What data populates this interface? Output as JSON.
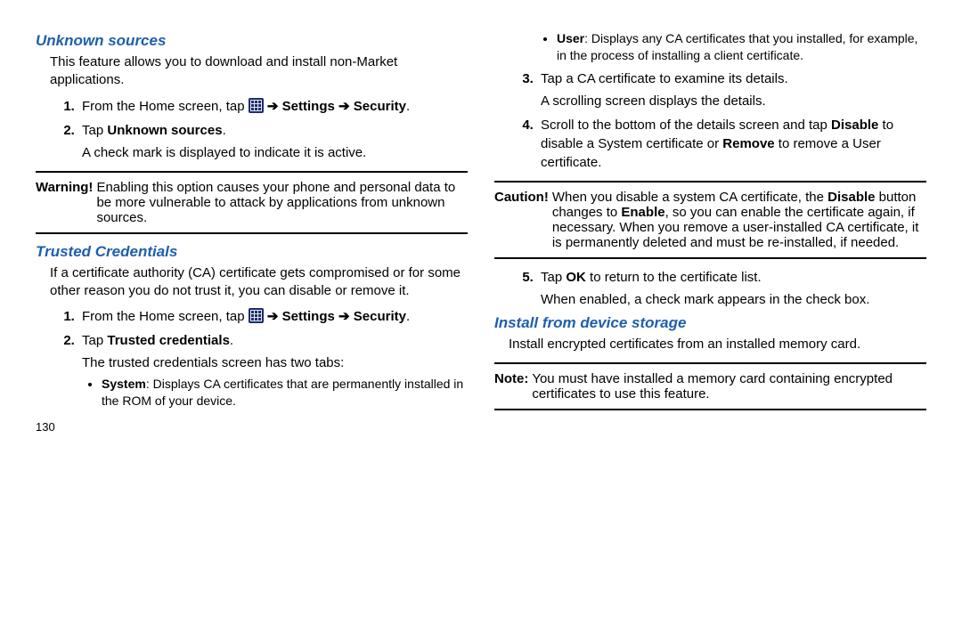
{
  "pageNumber": "130",
  "arrow": "➔",
  "left": {
    "h1": "Unknown sources",
    "intro1": "This feature allows you to download and install non-Market applications.",
    "step1_pre": "From the Home screen, tap ",
    "settings": "Settings",
    "security": "Security",
    "step2_pre": "Tap ",
    "step2_b": "Unknown sources",
    "step2_post": ".",
    "step2_sub": "A check mark is displayed to indicate it is active.",
    "warn_label": "Warning!",
    "warn_body": "Enabling this option causes your phone and personal data to be more vulnerable to attack by applications from unknown sources.",
    "h2": "Trusted Credentials",
    "intro2": "If a certificate authority (CA) certificate gets compromised or for some other reason you do not trust it, you can disable or remove it.",
    "step2b_b": "Trusted credentials",
    "step2b_sub": "The trusted credentials screen has two tabs:",
    "bullet_sys_b": "System",
    "bullet_sys": ": Displays CA certificates that are permanently installed in the ROM of your device."
  },
  "right": {
    "bullet_user_b": "User",
    "bullet_user": ": Displays any CA certificates that you installed, for example, in the process of installing a client certificate.",
    "step3a": "Tap a CA certificate to examine its details.",
    "step3b": "A scrolling screen displays the details.",
    "step4_pre": "Scroll to the bottom of the details screen and tap ",
    "step4_b1": "Disable",
    "step4_mid": " to disable a System certificate or ",
    "step4_b2": "Remove",
    "step4_post": " to remove a User certificate.",
    "caution_label": "Caution!",
    "caution_pre": "When you disable a system CA certificate, the ",
    "caution_b1": "Disable",
    "caution_mid1": " button changes to ",
    "caution_b2": "Enable",
    "caution_post": ", so you can enable the certificate again, if necessary. When you remove a user-installed CA certificate, it is permanently deleted and must be re-installed, if needed.",
    "step5_pre": "Tap ",
    "step5_b": "OK",
    "step5_post": " to return to the certificate list.",
    "step5_sub": "When enabled, a check mark appears in the check box.",
    "h3": "Install from device storage",
    "intro3": "Install encrypted certificates from an installed memory card.",
    "note_label": "Note:",
    "note_body": "You must have installed a memory card containing encrypted certificates to use this feature."
  }
}
